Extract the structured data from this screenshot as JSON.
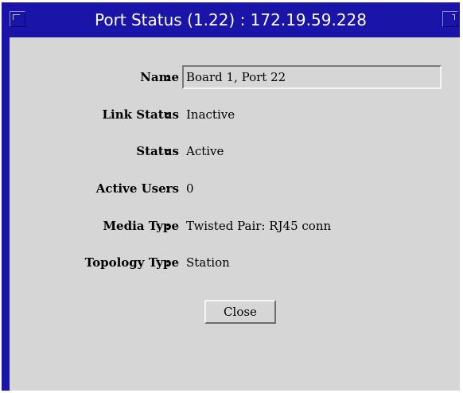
{
  "window": {
    "title": "Port Status (1.22) : 172.19.59.228"
  },
  "fields": {
    "name": {
      "label": "Name",
      "value": "Board 1, Port 22"
    },
    "link_status": {
      "label": "Link Status",
      "value": "Inactive"
    },
    "status": {
      "label": "Status",
      "value": "Active"
    },
    "active_users": {
      "label": "Active Users",
      "value": "0"
    },
    "media_type": {
      "label": "Media Type",
      "value": "Twisted Pair: RJ45 conn"
    },
    "topology_type": {
      "label": "Topology Type",
      "value": "Station"
    }
  },
  "colon": ":",
  "buttons": {
    "close_label": "Close"
  },
  "icons": {
    "left_title_button": "window-menu-icon",
    "right_title_button": "window-resize-icon"
  },
  "colors": {
    "titlebar": "#1a14a8",
    "client_bg": "#d6d6d6"
  }
}
